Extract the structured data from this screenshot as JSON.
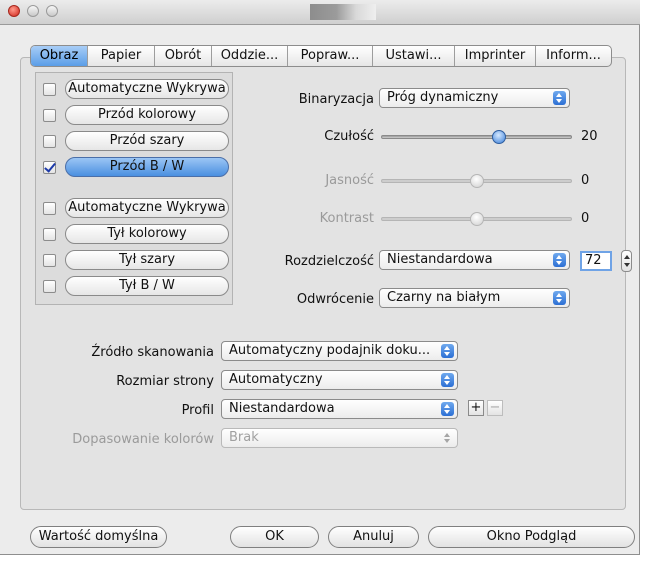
{
  "tabs": [
    "Obraz",
    "Papier",
    "Obrót",
    "Oddzie...",
    "Popraw...",
    "Ustawi...",
    "Imprinter",
    "Inform..."
  ],
  "selected_tab": "Obraz",
  "scan_options": [
    {
      "label": "Automatyczne Wykrywa",
      "checked": false
    },
    {
      "label": "Przód kolorowy",
      "checked": false
    },
    {
      "label": "Przód szary",
      "checked": false
    },
    {
      "label": "Przód B / W",
      "checked": true
    },
    {
      "label": "Automatyczne Wykrywa",
      "checked": false
    },
    {
      "label": "Tył kolorowy",
      "checked": false
    },
    {
      "label": "Tył szary",
      "checked": false
    },
    {
      "label": "Tył B / W",
      "checked": false
    }
  ],
  "binarization": {
    "label": "Binaryzacja",
    "value": "Próg dynamiczny"
  },
  "sensitivity": {
    "label": "Czułość",
    "value": "20",
    "level": 0.62
  },
  "brightness": {
    "label": "Jasność",
    "value": "0",
    "level": 0.5,
    "enabled": false
  },
  "contrast": {
    "label": "Kontrast",
    "value": "0",
    "level": 0.5,
    "enabled": false
  },
  "resolution": {
    "label": "Rozdzielczość",
    "value": "Niestandardowa",
    "number": "72"
  },
  "inversion": {
    "label": "Odwrócenie",
    "value": "Czarny na białym"
  },
  "scan_source": {
    "label": "Źródło skanowania",
    "value": "Automatyczny podajnik doku..."
  },
  "page_size": {
    "label": "Rozmiar strony",
    "value": "Automatyczny"
  },
  "profile": {
    "label": "Profil",
    "value": "Niestandardowa",
    "add": "+",
    "remove": "−"
  },
  "color_matching": {
    "label": "Dopasowanie kolorów",
    "value": "Brak",
    "enabled": false
  },
  "buttons": {
    "default": "Wartość domyślna",
    "ok": "OK",
    "cancel": "Anuluj",
    "preview": "Okno Podgląd"
  },
  "colors": {
    "accent": "#4a8fe0",
    "close": "#d0241a"
  }
}
